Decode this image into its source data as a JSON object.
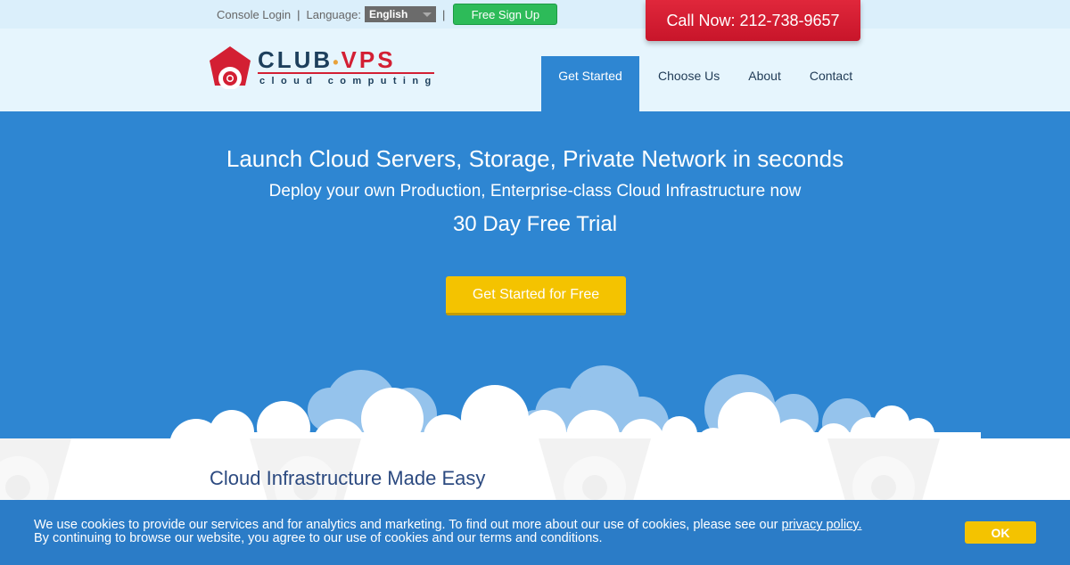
{
  "topbar": {
    "console_login": "Console Login",
    "separator": "|",
    "language_label": "Language:",
    "language_selected": "English",
    "signup_label": "Free Sign Up",
    "call_label": "Call Now: 212-738-9657"
  },
  "logo": {
    "brand_main": "CLUB",
    "brand_dot": "•",
    "brand_accent": "VPS",
    "tagline": "cloud computing"
  },
  "nav": {
    "items": [
      {
        "label": "Get Started",
        "active": true
      },
      {
        "label": "Choose Us",
        "active": false
      },
      {
        "label": "About",
        "active": false
      },
      {
        "label": "Contact",
        "active": false
      }
    ]
  },
  "hero": {
    "headline": "Launch Cloud Servers, Storage, Private Network in seconds",
    "subheadline": "Deploy your own Production, Enterprise-class Cloud Infrastructure now",
    "trial": "30 Day Free Trial",
    "cta_label": "Get Started for Free"
  },
  "section": {
    "title": "Cloud Infrastructure Made Easy"
  },
  "cookie": {
    "line1_text": "We use cookies to provide our services and for analytics and marketing. To find out more about our use of cookies, please see our ",
    "link_text": "privacy policy.",
    "line2_text": "By continuing to browse our website, you agree to our use of cookies and our terms and conditions.",
    "ok_label": "OK"
  },
  "colors": {
    "brand_blue": "#2e86d2",
    "brand_red": "#d31f33",
    "cta_yellow": "#f4c300",
    "signup_green": "#2dbb59"
  }
}
